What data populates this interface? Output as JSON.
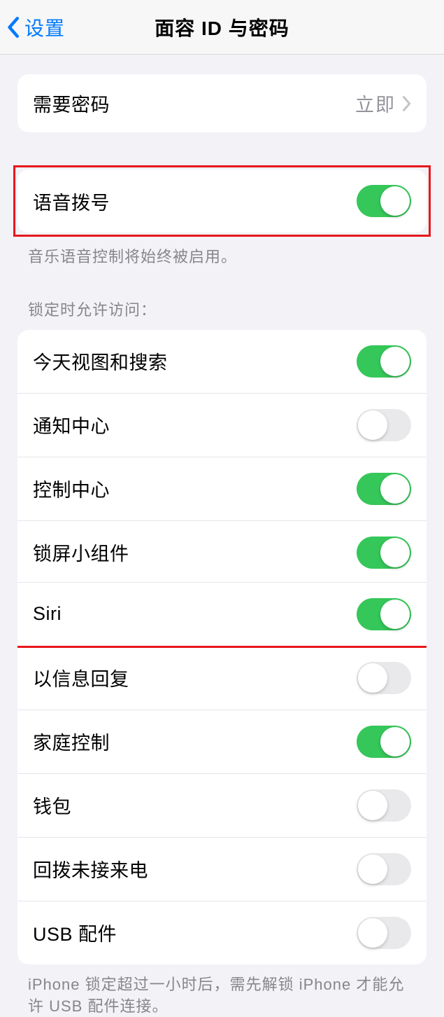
{
  "nav": {
    "back_label": "设置",
    "title": "面容 ID 与密码"
  },
  "require_passcode": {
    "label": "需要密码",
    "value": "立即"
  },
  "voice_dial": {
    "label": "语音拨号",
    "on": true,
    "footer": "音乐语音控制将始终被启用。"
  },
  "lock_access": {
    "header": "锁定时允许访问：",
    "items": [
      {
        "label": "今天视图和搜索",
        "on": true,
        "highlighted": false,
        "key": "today-view"
      },
      {
        "label": "通知中心",
        "on": false,
        "highlighted": false,
        "key": "notification-center"
      },
      {
        "label": "控制中心",
        "on": true,
        "highlighted": false,
        "key": "control-center"
      },
      {
        "label": "锁屏小组件",
        "on": true,
        "highlighted": false,
        "key": "lock-screen-widgets"
      },
      {
        "label": "Siri",
        "on": true,
        "highlighted": true,
        "key": "siri"
      },
      {
        "label": "以信息回复",
        "on": false,
        "highlighted": false,
        "key": "reply-with-message"
      },
      {
        "label": "家庭控制",
        "on": true,
        "highlighted": false,
        "key": "home-control"
      },
      {
        "label": "钱包",
        "on": false,
        "highlighted": false,
        "key": "wallet"
      },
      {
        "label": "回拨未接来电",
        "on": false,
        "highlighted": false,
        "key": "return-missed-calls"
      },
      {
        "label": "USB 配件",
        "on": false,
        "highlighted": false,
        "key": "usb-accessories"
      }
    ],
    "footer": "iPhone 锁定超过一小时后，需先解锁 iPhone 才能允许 USB 配件连接。"
  }
}
